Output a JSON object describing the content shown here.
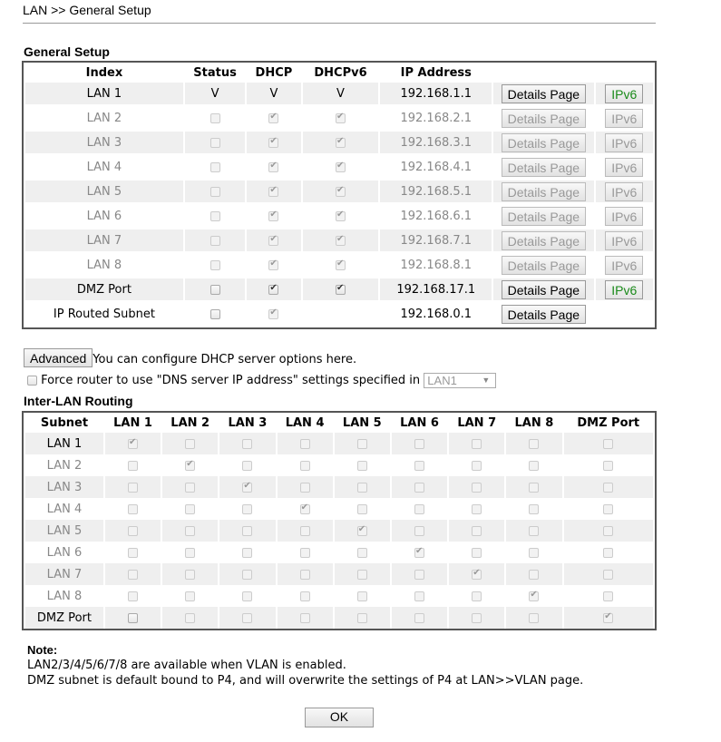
{
  "header": {
    "title": "LAN >> General Setup"
  },
  "general": {
    "section_title": "General Setup",
    "columns": [
      "Index",
      "Status",
      "DHCP",
      "DHCPv6",
      "IP Address"
    ],
    "rows": [
      {
        "index": "LAN 1",
        "status": "V",
        "dhcp": "V",
        "dhcpv6": "V",
        "ip": "192.168.1.1",
        "details": "Details Page",
        "ipv6": "IPv6",
        "enabled": true,
        "text_values": true
      },
      {
        "index": "LAN 2",
        "status": false,
        "dhcp": true,
        "dhcpv6": true,
        "ip": "192.168.2.1",
        "details": "Details Page",
        "ipv6": "IPv6",
        "enabled": false
      },
      {
        "index": "LAN 3",
        "status": false,
        "dhcp": true,
        "dhcpv6": true,
        "ip": "192.168.3.1",
        "details": "Details Page",
        "ipv6": "IPv6",
        "enabled": false
      },
      {
        "index": "LAN 4",
        "status": false,
        "dhcp": true,
        "dhcpv6": true,
        "ip": "192.168.4.1",
        "details": "Details Page",
        "ipv6": "IPv6",
        "enabled": false
      },
      {
        "index": "LAN 5",
        "status": false,
        "dhcp": true,
        "dhcpv6": true,
        "ip": "192.168.5.1",
        "details": "Details Page",
        "ipv6": "IPv6",
        "enabled": false
      },
      {
        "index": "LAN 6",
        "status": false,
        "dhcp": true,
        "dhcpv6": true,
        "ip": "192.168.6.1",
        "details": "Details Page",
        "ipv6": "IPv6",
        "enabled": false
      },
      {
        "index": "LAN 7",
        "status": false,
        "dhcp": true,
        "dhcpv6": true,
        "ip": "192.168.7.1",
        "details": "Details Page",
        "ipv6": "IPv6",
        "enabled": false
      },
      {
        "index": "LAN 8",
        "status": false,
        "dhcp": true,
        "dhcpv6": true,
        "ip": "192.168.8.1",
        "details": "Details Page",
        "ipv6": "IPv6",
        "enabled": false
      },
      {
        "index": "DMZ Port",
        "status": false,
        "dhcp": true,
        "dhcpv6": true,
        "ip": "192.168.17.1",
        "details": "Details Page",
        "ipv6": "IPv6",
        "enabled": true
      },
      {
        "index": "IP Routed Subnet",
        "status": false,
        "dhcp": true,
        "dhcpv6": null,
        "ip": "192.168.0.1",
        "details": "Details Page",
        "ipv6": null,
        "enabled": true,
        "dhcp_disabled": true
      }
    ]
  },
  "advanced": {
    "button_label": "Advanced",
    "text": "You can configure DHCP server options here."
  },
  "dns": {
    "checked": false,
    "label": "Force router to use \"DNS server IP address\" settings specified in",
    "select_value": "LAN1"
  },
  "inter_lan": {
    "section_title": "Inter-LAN Routing",
    "columns": [
      "Subnet",
      "LAN 1",
      "LAN 2",
      "LAN 3",
      "LAN 4",
      "LAN 5",
      "LAN 6",
      "LAN 7",
      "LAN 8",
      "DMZ Port"
    ],
    "rows": [
      {
        "subnet": "LAN 1",
        "checked": [
          1,
          0,
          0,
          0,
          0,
          0,
          0,
          0,
          0
        ]
      },
      {
        "subnet": "LAN 2",
        "checked": [
          0,
          1,
          0,
          0,
          0,
          0,
          0,
          0,
          0
        ]
      },
      {
        "subnet": "LAN 3",
        "checked": [
          0,
          0,
          1,
          0,
          0,
          0,
          0,
          0,
          0
        ]
      },
      {
        "subnet": "LAN 4",
        "checked": [
          0,
          0,
          0,
          1,
          0,
          0,
          0,
          0,
          0
        ]
      },
      {
        "subnet": "LAN 5",
        "checked": [
          0,
          0,
          0,
          0,
          1,
          0,
          0,
          0,
          0
        ]
      },
      {
        "subnet": "LAN 6",
        "checked": [
          0,
          0,
          0,
          0,
          0,
          1,
          0,
          0,
          0
        ]
      },
      {
        "subnet": "LAN 7",
        "checked": [
          0,
          0,
          0,
          0,
          0,
          0,
          1,
          0,
          0
        ]
      },
      {
        "subnet": "LAN 8",
        "checked": [
          0,
          0,
          0,
          0,
          0,
          0,
          0,
          1,
          0
        ]
      },
      {
        "subnet": "DMZ Port",
        "checked": [
          0,
          0,
          0,
          0,
          0,
          0,
          0,
          0,
          1
        ]
      }
    ]
  },
  "note": {
    "title": "Note:",
    "lines": [
      "LAN2/3/4/5/6/7/8 are available when VLAN is enabled.",
      "DMZ subnet is default bound to P4, and will overwrite the settings of P4 at LAN>>VLAN page."
    ]
  },
  "footer": {
    "ok_label": "OK"
  },
  "colors": {
    "ipv6_enabled": "#1a8a1a",
    "row_shade": "#efefef",
    "muted_text": "#888888"
  }
}
